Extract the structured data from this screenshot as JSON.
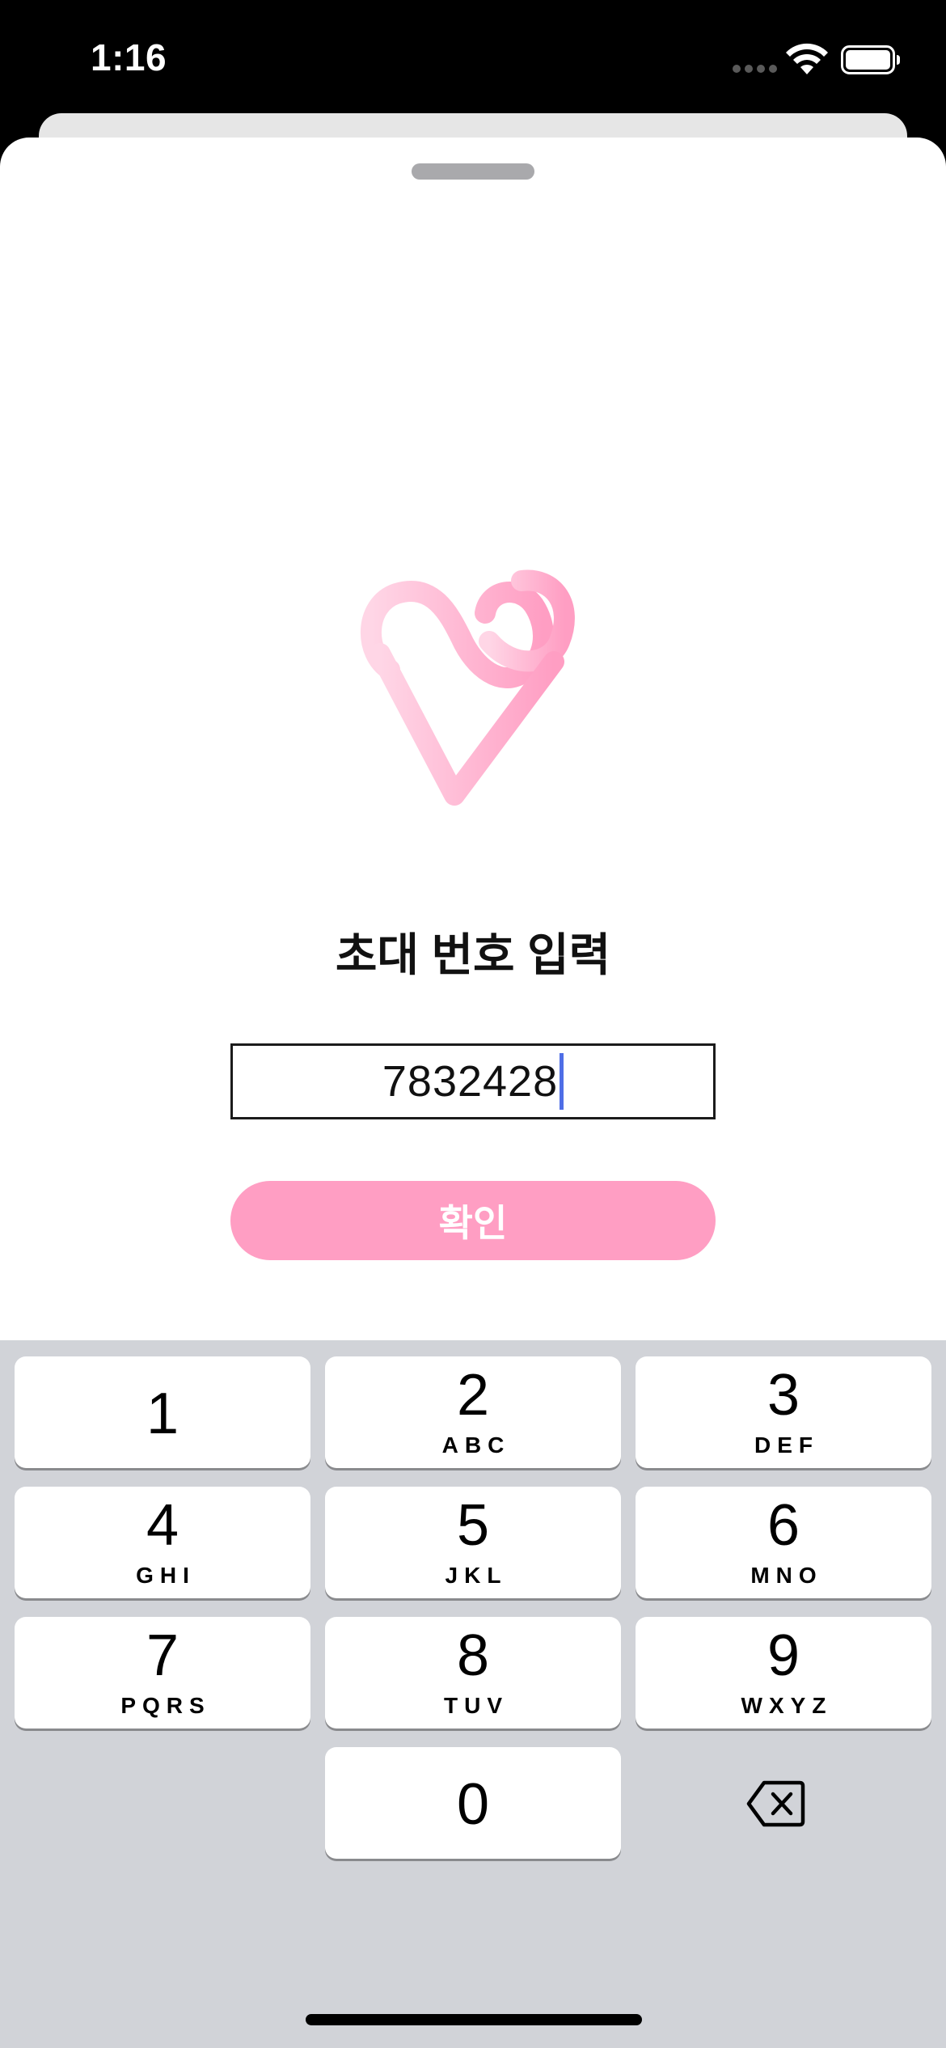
{
  "status_bar": {
    "time": "1:16",
    "wifi_icon": "wifi-icon",
    "battery_icon": "battery-icon"
  },
  "sheet": {
    "title": "초대 번호 입력",
    "code_input": {
      "value": "7832428"
    },
    "confirm_label": "확인",
    "colors": {
      "accent": "#ff9ec3",
      "caret": "#4f6ee6"
    }
  },
  "keypad": {
    "keys": [
      {
        "digit": "1",
        "letters": ""
      },
      {
        "digit": "2",
        "letters": "ABC"
      },
      {
        "digit": "3",
        "letters": "DEF"
      },
      {
        "digit": "4",
        "letters": "GHI"
      },
      {
        "digit": "5",
        "letters": "JKL"
      },
      {
        "digit": "6",
        "letters": "MNO"
      },
      {
        "digit": "7",
        "letters": "PQRS"
      },
      {
        "digit": "8",
        "letters": "TUV"
      },
      {
        "digit": "9",
        "letters": "WXYZ"
      },
      {
        "digit": "0",
        "letters": ""
      }
    ],
    "delete_icon": "backspace-icon"
  }
}
